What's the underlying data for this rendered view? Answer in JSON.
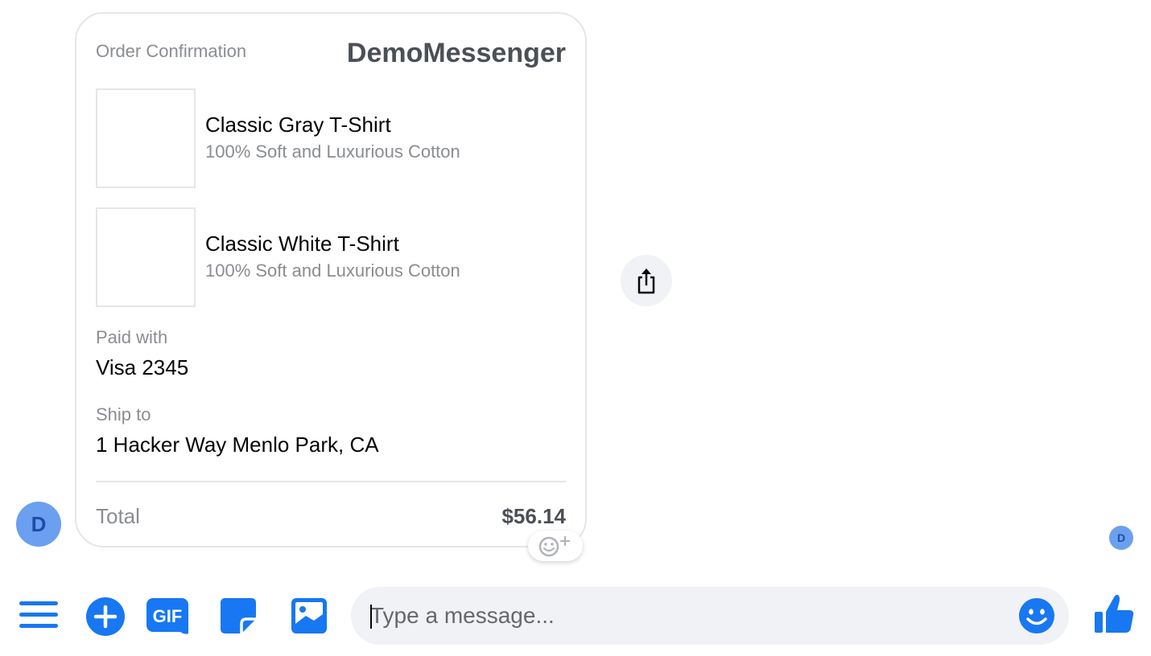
{
  "receipt": {
    "type_label": "Order Confirmation",
    "brand": "DemoMessenger",
    "items": [
      {
        "name": "Classic Gray T-Shirt",
        "description": "100% Soft and Luxurious Cotton"
      },
      {
        "name": "Classic White T-Shirt",
        "description": "100% Soft and Luxurious Cotton"
      }
    ],
    "paid_with_label": "Paid with",
    "paid_with_value": "Visa 2345",
    "ship_to_label": "Ship to",
    "ship_to_value": "1 Hacker Way Menlo Park, CA",
    "total_label": "Total",
    "total_value": "$56.14"
  },
  "sender_avatar": {
    "initial": "D"
  },
  "seen_avatar": {
    "initial": "D"
  },
  "composer": {
    "placeholder": "Type a message..."
  },
  "colors": {
    "accent": "#1877f2",
    "border": "#e4e6eb",
    "muted_text": "#8a8d91",
    "avatar_bg": "#6b9ff0"
  },
  "icons": {
    "menu": "hamburger-icon",
    "add": "plus-circle-icon",
    "gif": "gif-icon",
    "sticker": "sticker-icon",
    "image": "image-icon",
    "emoji": "smiley-icon",
    "like": "thumbs-up-icon",
    "share": "share-icon",
    "reaction": "add-reaction-icon"
  }
}
